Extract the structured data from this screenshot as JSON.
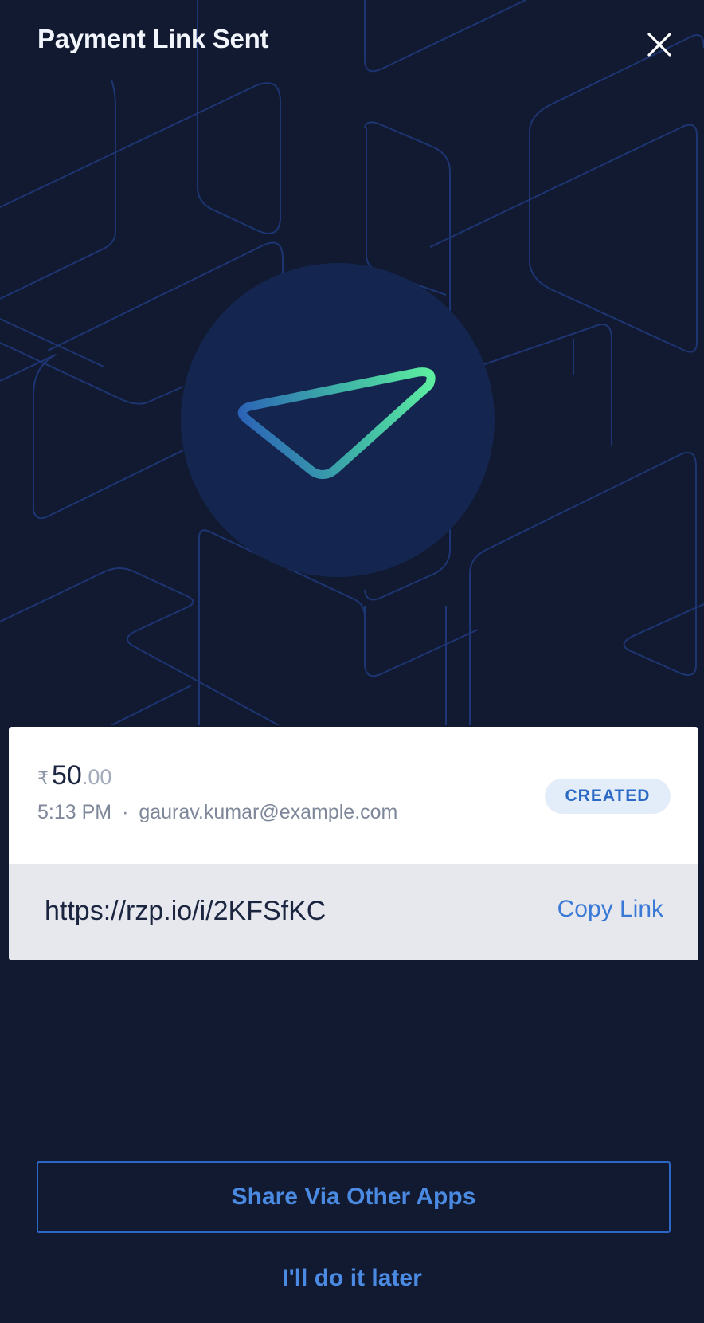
{
  "header": {
    "title": "Payment Link Sent",
    "close_icon": "close-icon"
  },
  "hero": {
    "icon": "send-arrow-icon"
  },
  "payment": {
    "currency_symbol": "₹",
    "amount_main": "50",
    "amount_decimal": ".00",
    "time": "5:13 PM",
    "separator": "·",
    "email": "gaurav.kumar@example.com",
    "status": "CREATED"
  },
  "link": {
    "url": "https://rzp.io/i/2KFSfKC",
    "copy_label": "Copy Link"
  },
  "actions": {
    "share_label": "Share Via Other Apps",
    "later_label": "I'll do it later"
  },
  "colors": {
    "background": "#111a31",
    "accent": "#3a7ad6",
    "status_badge_bg": "#e3edf9",
    "gradient_start": "#2a5fb8",
    "gradient_end": "#5ef0a0"
  }
}
